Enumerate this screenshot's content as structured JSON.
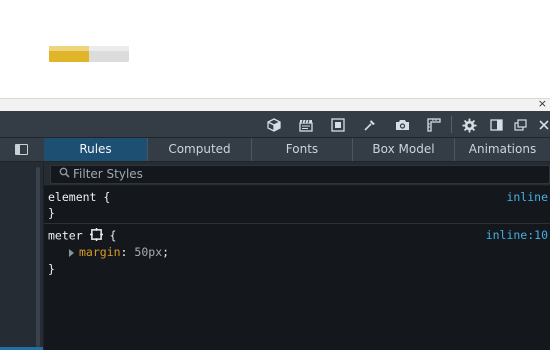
{
  "viewport": {
    "meter": {
      "value": 0.5,
      "fill_color": "#e0b52a",
      "track_color": "#dcdcdc"
    }
  },
  "splitter": {
    "close_glyph": "×"
  },
  "toolbar": {
    "icons": [
      "box-3d-icon",
      "clapperboard-icon",
      "responsive-mode-icon",
      "eyedropper-icon",
      "camera-icon",
      "ruler-icon",
      "gear-icon",
      "dock-side-icon",
      "popout-icon",
      "close-icon"
    ]
  },
  "tabs": [
    {
      "label": "Rules",
      "selected": true
    },
    {
      "label": "Computed",
      "selected": false
    },
    {
      "label": "Fonts",
      "selected": false
    },
    {
      "label": "Box Model",
      "selected": false
    },
    {
      "label": "Animations",
      "selected": false
    }
  ],
  "filter": {
    "placeholder": "Filter Styles",
    "value": ""
  },
  "rules": [
    {
      "selector": "element",
      "open": "{",
      "close": "}",
      "source": "inline",
      "declarations": []
    },
    {
      "selector": "meter",
      "open": "{",
      "close": "}",
      "source": "inline:10",
      "declarations": [
        {
          "name": "margin",
          "colon": ":",
          "value": "50px",
          "semi": ";"
        }
      ]
    }
  ],
  "colors": {
    "accent": "#1d4f73",
    "link": "#46afe3",
    "property": "#d99b28"
  }
}
